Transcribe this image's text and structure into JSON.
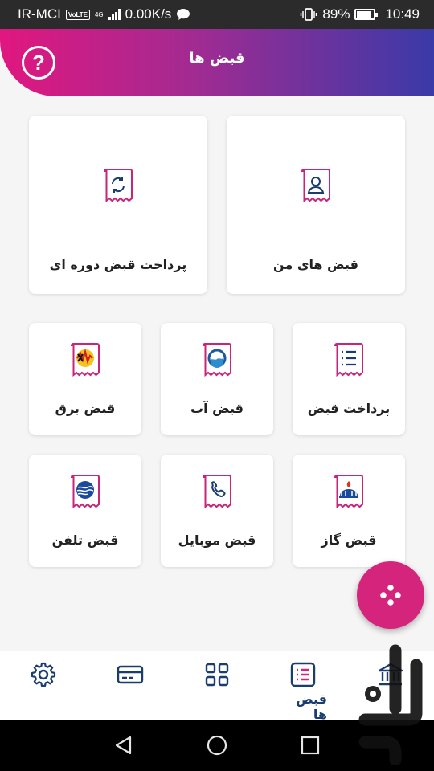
{
  "status_bar": {
    "carrier": "IR-MCI",
    "volte": "VoLTE",
    "network": "4G",
    "speed": "0.00K/s",
    "battery": "89%",
    "time": "10:49"
  },
  "header": {
    "title": "قبض ها"
  },
  "cards": {
    "my_bills": "قبض های من",
    "periodic": "پرداخت قبض دوره ای",
    "pay_bill": "پرداخت قبض",
    "water": "قبض آب",
    "electricity": "قبض برق",
    "gas": "قبض گاز",
    "mobile": "قبض موبایل",
    "phone": "قبض تلفن"
  },
  "bottom_nav": {
    "active_label": "قبض ها",
    "active_item": "bills"
  },
  "colors": {
    "accent_pink": "#d4247c",
    "gradient_start": "#e0177f",
    "gradient_end": "#3a3aa8",
    "nav_blue": "#1a3c6e"
  }
}
